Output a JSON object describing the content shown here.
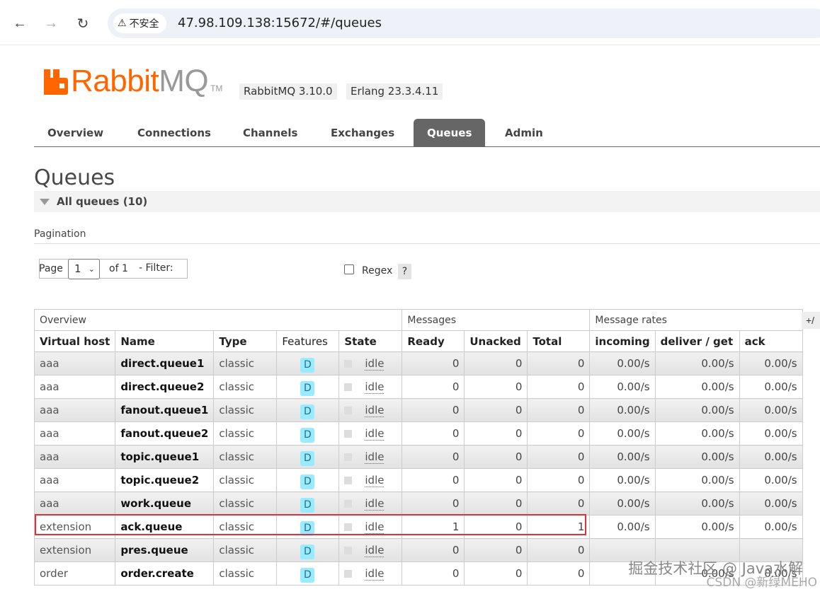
{
  "browser": {
    "security_label": "不安全",
    "url": "47.98.109.138:15672/#/queues"
  },
  "header": {
    "logo_rabbit": "Rabbit",
    "logo_mq": "MQ",
    "logo_tm": "TM",
    "rabbitmq_version": "RabbitMQ 3.10.0",
    "erlang_version": "Erlang 23.3.4.11"
  },
  "tabs": [
    {
      "label": "Overview",
      "active": false
    },
    {
      "label": "Connections",
      "active": false
    },
    {
      "label": "Channels",
      "active": false
    },
    {
      "label": "Exchanges",
      "active": false
    },
    {
      "label": "Queues",
      "active": true
    },
    {
      "label": "Admin",
      "active": false
    }
  ],
  "page": {
    "title": "Queues",
    "section_title": "All queues (10)",
    "pagination_label": "Pagination"
  },
  "pagination": {
    "page_label": "Page",
    "page_value": "1",
    "of_label": "of 1",
    "filter_label": "- Filter:",
    "filter_value": "",
    "regex_label": "Regex",
    "help_label": "?",
    "regex_checked": false
  },
  "table": {
    "group_headers": [
      "Overview",
      "Messages",
      "Message rates"
    ],
    "columns": [
      "Virtual host",
      "Name",
      "Type",
      "Features",
      "State",
      "Ready",
      "Unacked",
      "Total",
      "incoming",
      "deliver / get",
      "ack"
    ],
    "toggle_label": "+/",
    "rows": [
      {
        "vhost": "aaa",
        "name": "direct.queue1",
        "type": "classic",
        "feature": "D",
        "state": "idle",
        "ready": "0",
        "unacked": "0",
        "total": "0",
        "incoming": "0.00/s",
        "deliver": "0.00/s",
        "ack": "0.00/s"
      },
      {
        "vhost": "aaa",
        "name": "direct.queue2",
        "type": "classic",
        "feature": "D",
        "state": "idle",
        "ready": "0",
        "unacked": "0",
        "total": "0",
        "incoming": "0.00/s",
        "deliver": "0.00/s",
        "ack": "0.00/s"
      },
      {
        "vhost": "aaa",
        "name": "fanout.queue1",
        "type": "classic",
        "feature": "D",
        "state": "idle",
        "ready": "0",
        "unacked": "0",
        "total": "0",
        "incoming": "0.00/s",
        "deliver": "0.00/s",
        "ack": "0.00/s"
      },
      {
        "vhost": "aaa",
        "name": "fanout.queue2",
        "type": "classic",
        "feature": "D",
        "state": "idle",
        "ready": "0",
        "unacked": "0",
        "total": "0",
        "incoming": "0.00/s",
        "deliver": "0.00/s",
        "ack": "0.00/s"
      },
      {
        "vhost": "aaa",
        "name": "topic.queue1",
        "type": "classic",
        "feature": "D",
        "state": "idle",
        "ready": "0",
        "unacked": "0",
        "total": "0",
        "incoming": "0.00/s",
        "deliver": "0.00/s",
        "ack": "0.00/s"
      },
      {
        "vhost": "aaa",
        "name": "topic.queue2",
        "type": "classic",
        "feature": "D",
        "state": "idle",
        "ready": "0",
        "unacked": "0",
        "total": "0",
        "incoming": "0.00/s",
        "deliver": "0.00/s",
        "ack": "0.00/s"
      },
      {
        "vhost": "aaa",
        "name": "work.queue",
        "type": "classic",
        "feature": "D",
        "state": "idle",
        "ready": "0",
        "unacked": "0",
        "total": "0",
        "incoming": "0.00/s",
        "deliver": "0.00/s",
        "ack": "0.00/s"
      },
      {
        "vhost": "extension",
        "name": "ack.queue",
        "type": "classic",
        "feature": "D",
        "state": "idle",
        "ready": "1",
        "unacked": "0",
        "total": "1",
        "incoming": "0.00/s",
        "deliver": "0.00/s",
        "ack": "0.00/s"
      },
      {
        "vhost": "extension",
        "name": "pres.queue",
        "type": "classic",
        "feature": "D",
        "state": "idle",
        "ready": "0",
        "unacked": "0",
        "total": "0",
        "incoming": "",
        "deliver": "",
        "ack": ""
      },
      {
        "vhost": "order",
        "name": "order.create",
        "type": "classic",
        "feature": "D",
        "state": "idle",
        "ready": "0",
        "unacked": "0",
        "total": "0",
        "incoming": "",
        "deliver": "0.00/s",
        "ack": "0.00/s"
      }
    ]
  },
  "watermark": {
    "line1": "掘金技术社区 @ Java水解",
    "line2": "CSDN @新绿MEHO"
  },
  "colors": {
    "brand": "#ff6600",
    "tab_active": "#666666",
    "highlight": "#e0303a",
    "feature_badge": "#99ebff"
  }
}
